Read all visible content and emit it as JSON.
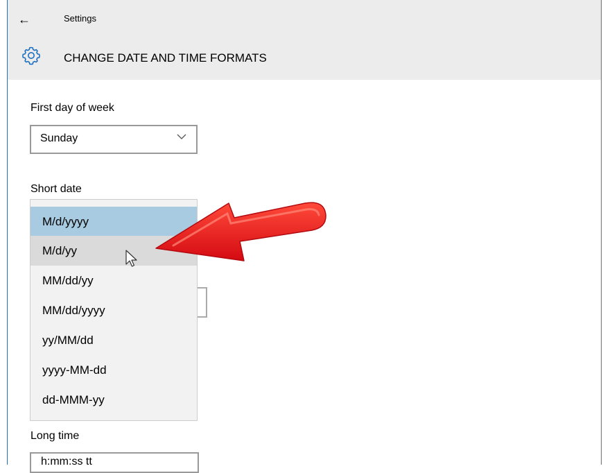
{
  "window": {
    "title": "Settings",
    "back_icon": "back-arrow-icon"
  },
  "page": {
    "title": "CHANGE DATE AND TIME FORMATS",
    "icon": "gear-icon",
    "accent": "#1e6fc2"
  },
  "first_day": {
    "label": "First day of week",
    "value": "Sunday"
  },
  "short_date": {
    "label": "Short date",
    "options": [
      "M/d/yyyy",
      "M/d/yy",
      "MM/dd/yy",
      "MM/dd/yyyy",
      "yy/MM/dd",
      "yyyy-MM-dd",
      "dd-MMM-yy"
    ],
    "selected_index": 0,
    "hovered_index": 1
  },
  "long_time": {
    "label": "Long time",
    "value": "h:mm:ss tt"
  },
  "annotation": {
    "arrow_color": "#e8141a"
  }
}
